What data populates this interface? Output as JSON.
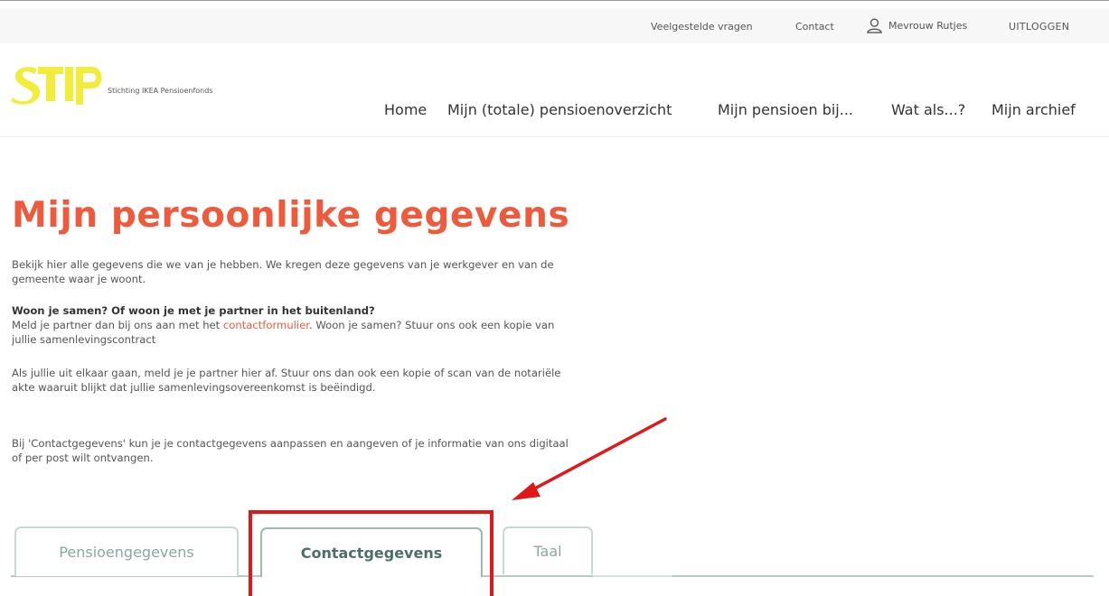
{
  "topbar": {
    "faq": "Veelgestelde vragen",
    "contact": "Contact",
    "user": "Mevrouw Rutjes",
    "logout": "UITLOGGEN"
  },
  "brand": {
    "logo_text": "SIP",
    "subtitle": "Stichting IKEA Pensioenfonds",
    "color": "#f2ec3a"
  },
  "nav": [
    {
      "label": "Home"
    },
    {
      "label": "Mijn (totale) pensioenoverzicht"
    },
    {
      "label": "Mijn pensioen bij..."
    },
    {
      "label": "Wat als...?"
    },
    {
      "label": "Mijn archief"
    }
  ],
  "page": {
    "title": "Mijn persoonlijke gegevens",
    "intro": "Bekijk hier alle gegevens die we van je hebben. We kregen deze gegevens van je werkgever en van de gemeente waar je woont.",
    "partner_heading": "Woon je samen? Of woon je met je partner in het buitenland?",
    "partner_pre": "Meld je partner dan bij ons aan met het ",
    "partner_link": "contactformulier",
    "partner_post": ". Woon je samen? Stuur ons ook een kopie van jullie samenlevingscontract",
    "separation": "Als jullie uit elkaar gaan, meld je je partner hier af. Stuur ons dan ook een kopie of scan van de notariële akte waaruit blijkt dat jullie samenlevingsovereenkomst is beëindigd.",
    "contact_info": "Bij 'Contactgegevens' kun je je contactgegevens aanpassen en aangeven of je informatie van ons digitaal of per post wilt ontvangen."
  },
  "tabs": [
    {
      "label": "Pensioengegevens"
    },
    {
      "label": "Contactgegevens"
    },
    {
      "label": "Taal"
    }
  ],
  "colors": {
    "accent": "#ef5a3c",
    "annotation": "#e01818",
    "tab_border": "#c8d9d5"
  }
}
